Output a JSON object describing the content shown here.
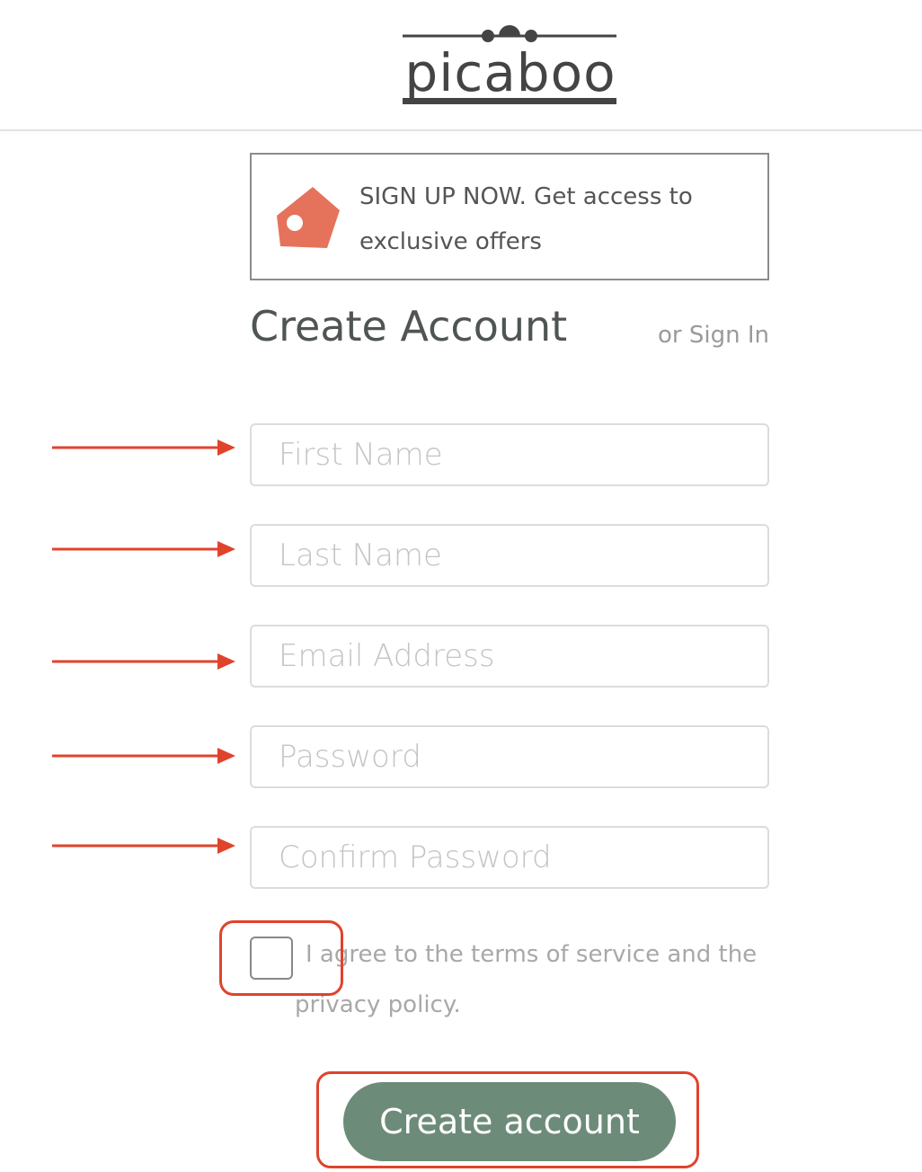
{
  "brand": {
    "logo_text": "picaboo"
  },
  "promo": {
    "text": "SIGN UP NOW. Get access to exclusive offers",
    "icon": "price-tag-icon"
  },
  "form": {
    "title": "Create Account",
    "sign_in_link": "or Sign In",
    "fields": {
      "first_name": {
        "placeholder": "First Name",
        "value": ""
      },
      "last_name": {
        "placeholder": "Last Name",
        "value": ""
      },
      "email": {
        "placeholder": "Email Address",
        "value": ""
      },
      "password": {
        "placeholder": "Password",
        "value": ""
      },
      "confirm_password": {
        "placeholder": "Confirm Password",
        "value": ""
      }
    },
    "agree_label": "I agree to the terms of service and the privacy policy.",
    "submit_label": "Create account"
  },
  "annotations": {
    "arrow_icon": "right-arrow-icon",
    "highlight_color": "#e0432c"
  },
  "colors": {
    "button": "#6d8b79",
    "promo_icon": "#e5735b",
    "title": "#4f5552"
  }
}
